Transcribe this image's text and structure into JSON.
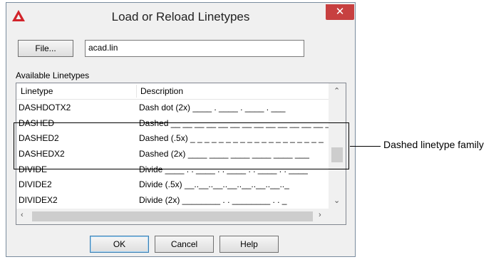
{
  "dialog": {
    "title": "Load or Reload Linetypes",
    "close_symbol": "✕",
    "file_button": "File...",
    "file_value": "acad.lin",
    "available_label": "Available Linetypes",
    "columns": {
      "linetype": "Linetype",
      "description": "Description"
    },
    "rows": [
      {
        "name": "DASHDOTX2",
        "desc": "Dash dot (2x) ____ . ____ . ____ . ___"
      },
      {
        "name": "DASHED",
        "desc": "Dashed __ __ __ __ __ __ __ __ __ __ __ __ __ _"
      },
      {
        "name": "DASHED2",
        "desc": "Dashed (.5x) _ _ _ _ _ _ _ _ _ _ _ _ _ _ _ _ _ _ _"
      },
      {
        "name": "DASHEDX2",
        "desc": "Dashed (2x) ____ ____ ____ ____ ____ ___"
      },
      {
        "name": "DIVIDE",
        "desc": "Divide ____ . . ____ . . ____ . . ____ . . ____"
      },
      {
        "name": "DIVIDE2",
        "desc": "Divide (.5x) __..__..__..__..__..__..__.._"
      },
      {
        "name": "DIVIDEX2",
        "desc": "Divide (2x) ________ . . ________ . . _"
      }
    ],
    "buttons": {
      "ok": "OK",
      "cancel": "Cancel",
      "help": "Help"
    }
  },
  "callout": {
    "label": "Dashed linetype family"
  },
  "icons": {
    "app": "autocad-logo-icon",
    "close": "close-icon",
    "scroll_up": "chevron-up-icon",
    "scroll_down": "chevron-down-icon",
    "scroll_left": "chevron-left-icon",
    "scroll_right": "chevron-right-icon"
  },
  "colors": {
    "close_button": "#c74040",
    "app_icon": "#d2232a"
  }
}
